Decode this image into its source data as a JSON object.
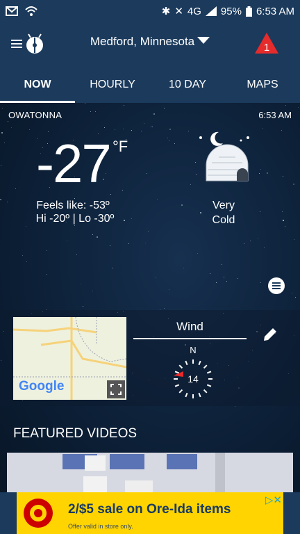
{
  "status": {
    "battery": "95%",
    "time": "6:53 AM",
    "network": "4G"
  },
  "header": {
    "location": "Medford, Minnesota",
    "alert_count": "1"
  },
  "tabs": [
    {
      "label": "NOW"
    },
    {
      "label": "HOURLY"
    },
    {
      "label": "10 DAY"
    },
    {
      "label": "MAPS"
    }
  ],
  "current": {
    "station": "OWATONNA",
    "time": "6:53 AM",
    "temp": "-27",
    "unit": "°F",
    "feels_like": "Feels like: -53º",
    "hilo": "Hi -20º  |  Lo -30º",
    "condition_line1": "Very",
    "condition_line2": "Cold"
  },
  "wind": {
    "title": "Wind",
    "direction": "N",
    "speed": "14"
  },
  "map": {
    "provider": "Google"
  },
  "featured": {
    "title": "FEATURED VIDEOS"
  },
  "ad": {
    "headline": "2/$5 sale on Ore-Ida items",
    "subtext": "Offer valid in store only."
  },
  "colors": {
    "header": "#1b3a5c",
    "alert": "#e52b2b",
    "ad": "#ffd400"
  }
}
